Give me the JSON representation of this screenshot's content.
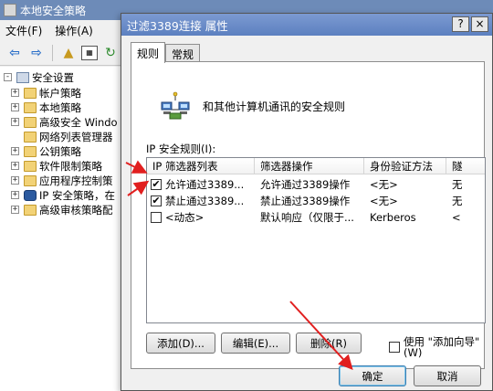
{
  "bg_window": {
    "title": "本地安全策略",
    "menu": [
      "文件(F)",
      "操作(A)"
    ],
    "tree": [
      {
        "label": "安全设置",
        "icon": "policy-icon",
        "level": 0,
        "expander": "-"
      },
      {
        "label": "帐户策略",
        "icon": "folder-icon",
        "level": 1,
        "expander": "+"
      },
      {
        "label": "本地策略",
        "icon": "folder-icon",
        "level": 1,
        "expander": "+"
      },
      {
        "label": "高级安全 Windo",
        "icon": "folder-icon",
        "level": 1,
        "expander": "+"
      },
      {
        "label": "网络列表管理器",
        "icon": "folder-icon",
        "level": 1,
        "expander": ""
      },
      {
        "label": "公钥策略",
        "icon": "folder-icon",
        "level": 1,
        "expander": "+"
      },
      {
        "label": "软件限制策略",
        "icon": "folder-icon",
        "level": 1,
        "expander": "+"
      },
      {
        "label": "应用程序控制策",
        "icon": "folder-icon",
        "level": 1,
        "expander": "+"
      },
      {
        "label": "IP 安全策略，在",
        "icon": "shield-icon",
        "level": 1,
        "expander": "+"
      },
      {
        "label": "高级审核策略配",
        "icon": "folder-icon",
        "level": 1,
        "expander": "+"
      }
    ]
  },
  "dialog": {
    "title": "过滤3389连接 属性",
    "help_btn": "?",
    "close_btn": "×",
    "tabs": [
      "规则",
      "常规"
    ],
    "description": "和其他计算机通讯的安全规则",
    "rules_label": "IP 安全规则(I):",
    "columns": [
      "IP 筛选器列表",
      "筛选器操作",
      "身份验证方法",
      "隧"
    ],
    "rows": [
      {
        "checked": true,
        "cells": [
          "允许通过3389...",
          "允许通过3389操作",
          "<无>",
          "无"
        ]
      },
      {
        "checked": true,
        "cells": [
          "禁止通过3389...",
          "禁止通过3389操作",
          "<无>",
          "无"
        ]
      },
      {
        "checked": false,
        "cells": [
          "<动态>",
          "默认响应（仅限于...",
          "Kerberos",
          "<"
        ]
      }
    ],
    "buttons": {
      "add": "添加(D)...",
      "edit": "编辑(E)...",
      "delete": "删除(R)",
      "ok": "确定",
      "cancel": "取消"
    },
    "use_wizard_label": "使用 \"添加向导\"(W)"
  },
  "colors": {
    "annotation_arrow": "#e11f1f",
    "title_bar": "#6d8bb8",
    "dialog_title": "#5c80c0"
  }
}
